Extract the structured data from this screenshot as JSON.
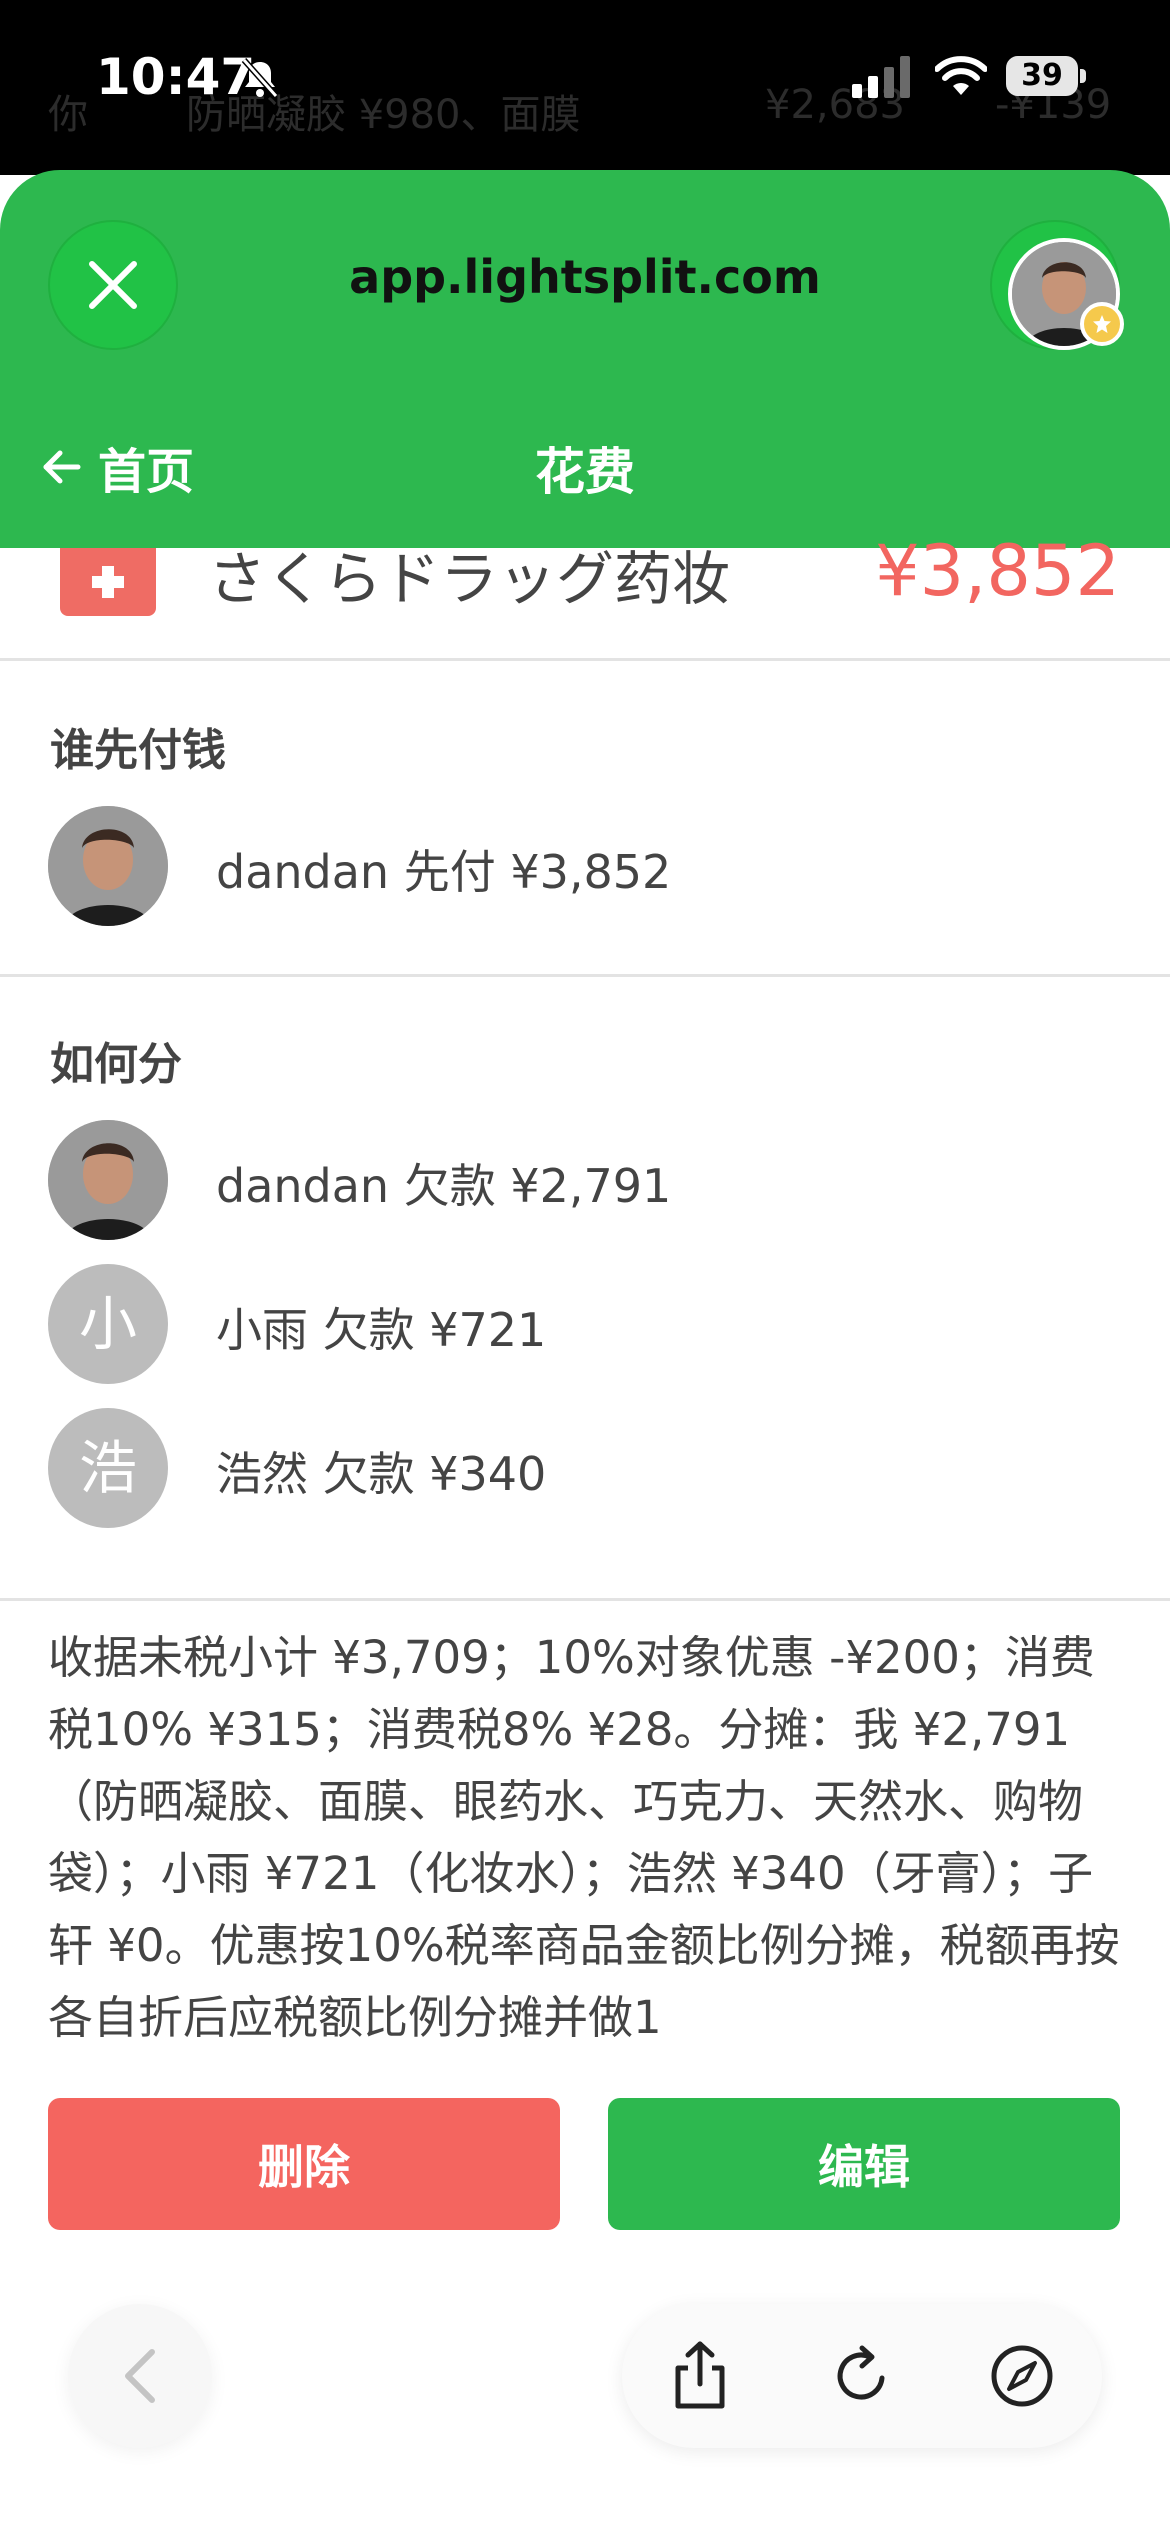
{
  "status_bar": {
    "time": "10:47",
    "battery": "39",
    "icons": [
      "bell-slash-icon",
      "signal-icon",
      "wifi-icon",
      "battery-icon"
    ]
  },
  "peek_behind": {
    "col_a": "你",
    "col_b": "防晒凝胶 ¥980、面膜",
    "col_c": "¥2,683",
    "col_d": "-¥139"
  },
  "browser": {
    "url": "app.lightsplit.com",
    "icons": [
      "close-icon",
      "tabs-icon"
    ]
  },
  "header": {
    "back_label": "首页",
    "title": "花费",
    "back_icon": "arrow-left-icon",
    "badge_icon": "star-badge-icon"
  },
  "expense": {
    "icon": "medical-cross-icon",
    "name": "さくらドラッグ药妆",
    "amount": "¥3,852",
    "amount_color": "#f26660"
  },
  "payer_section": {
    "title": "谁先付钱",
    "payer": {
      "text": "dandan 先付 ¥3,852"
    }
  },
  "split_section": {
    "title": "如何分",
    "people": [
      {
        "avatar_letter": "",
        "text": "dandan 欠款 ¥2,791"
      },
      {
        "avatar_letter": "小",
        "text": "小雨 欠款 ¥721"
      },
      {
        "avatar_letter": "浩",
        "text": "浩然 欠款 ¥340"
      }
    ]
  },
  "notes": "收据未税小计 ¥3,709；10%对象优惠 -¥200；消费税10% ¥315；消费税8% ¥28。分摊：我 ¥2,791（防晒凝胶、面膜、眼药水、巧克力、天然水、购物袋）；小雨 ¥721（化妆水）；浩然 ¥340（牙膏）；子轩 ¥0。优惠按10%税率商品金额比例分摊，税额再按各自折后应税额比例分摊并做1",
  "actions": {
    "delete_label": "删除",
    "edit_label": "编辑",
    "delete_color": "#f4655f",
    "edit_color": "#2db84f"
  },
  "toolbar": {
    "icons": [
      "back-chevron-icon",
      "share-icon",
      "reload-icon",
      "compass-icon"
    ]
  },
  "colors": {
    "brand_green": "#2db84f",
    "accent_red": "#f26660"
  }
}
